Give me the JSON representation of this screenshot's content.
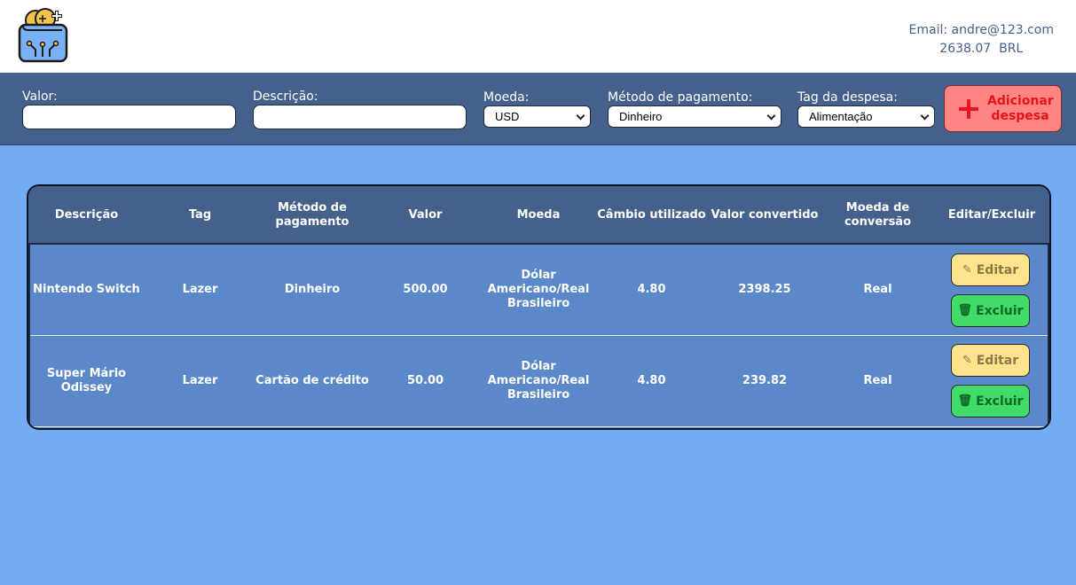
{
  "header": {
    "email_label": "Email: andre@123.com",
    "total": "2638.07",
    "currency": "BRL"
  },
  "form": {
    "valor_label": "Valor:",
    "valor_value": "",
    "descricao_label": "Descrição:",
    "descricao_value": "",
    "moeda_label": "Moeda:",
    "moeda_selected": "USD",
    "metodo_label": "Método de pagamento:",
    "metodo_selected": "Dinheiro",
    "tag_label": "Tag da despesa:",
    "tag_selected": "Alimentação",
    "add_label": "Adicionar despesa"
  },
  "table": {
    "headers": [
      "Descrição",
      "Tag",
      "Método de pagamento",
      "Valor",
      "Moeda",
      "Câmbio utilizado",
      "Valor convertido",
      "Moeda de conversão",
      "Editar/Excluir"
    ],
    "edit_label": "Editar",
    "delete_label": "Excluir",
    "rows": [
      {
        "descricao": "Nintendo Switch",
        "tag": "Lazer",
        "metodo": "Dinheiro",
        "valor": "500.00",
        "moeda": "Dólar Americano/Real Brasileiro",
        "cambio": "4.80",
        "convertido": "2398.25",
        "moeda_conversao": "Real"
      },
      {
        "descricao": "Super Mário Odissey",
        "tag": "Lazer",
        "metodo": "Cartão de crédito",
        "valor": "50.00",
        "moeda": "Dólar Americano/Real Brasileiro",
        "cambio": "4.80",
        "convertido": "239.82",
        "moeda_conversao": "Real"
      }
    ]
  },
  "colors": {
    "background": "#75aaf4",
    "bar": "#44608b",
    "row": "#5b88c9",
    "add_button": "#ff8585",
    "edit_button": "#ffe38c",
    "delete_button": "#41db67"
  },
  "icons": {
    "logo": "wallet-coins-logo",
    "add": "plus-icon",
    "edit": "edit-icon",
    "delete": "trash-icon"
  }
}
